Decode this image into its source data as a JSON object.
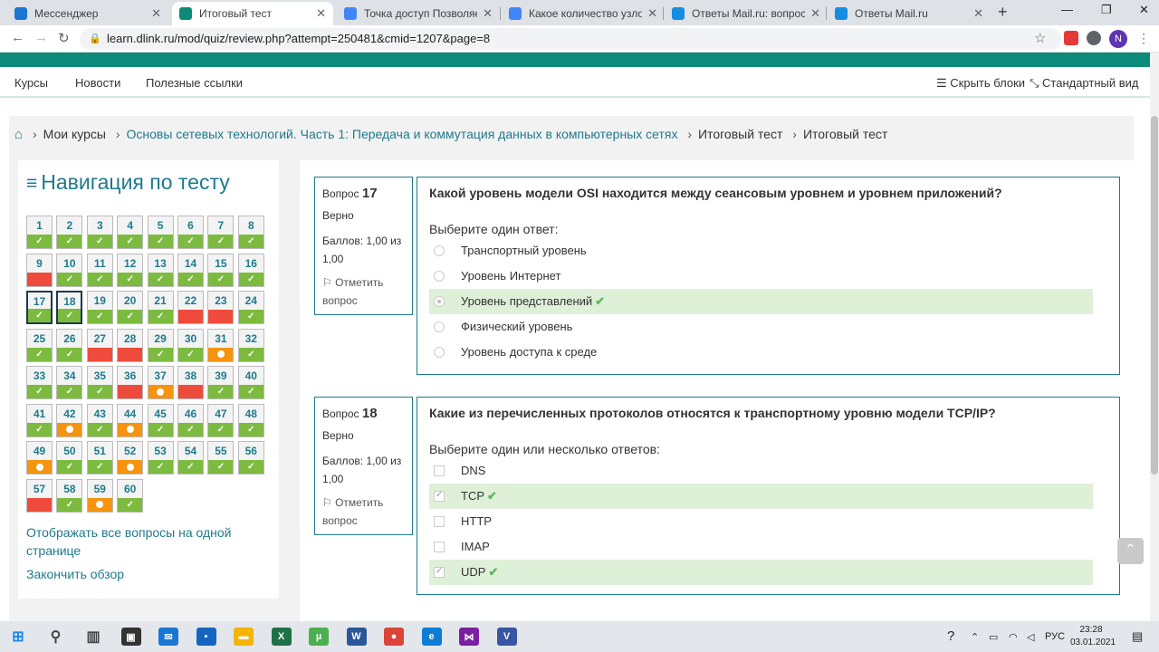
{
  "browser": {
    "tabs": [
      {
        "title": "Мессенджер",
        "icon": "messenger-icon",
        "color": "#1976d2"
      },
      {
        "title": "Итоговый тест",
        "icon": "dlink-icon",
        "color": "#0e8a7b"
      },
      {
        "title": "Точка доступ Позволяет об",
        "icon": "google-icon",
        "color": "#4285f4"
      },
      {
        "title": "Какое количество узлов до",
        "icon": "google-icon",
        "color": "#4285f4"
      },
      {
        "title": "Ответы Mail.ru: вопрос",
        "icon": "mailru-icon",
        "color": "#168de2"
      },
      {
        "title": "Ответы Mail.ru",
        "icon": "mailru-icon",
        "color": "#168de2"
      }
    ],
    "active_tab": 1,
    "url": "learn.dlink.ru/mod/quiz/review.php?attempt=250481&cmid=1207&page=8",
    "profile_initial": "N"
  },
  "site": {
    "nav": [
      "Курсы",
      "Новости",
      "Полезные ссылки"
    ],
    "hide_blocks": "Скрыть блоки",
    "standard_view": "Стандартный вид",
    "brand_color": "#0e8a7b",
    "link_color": "#1f7a8c"
  },
  "breadcrumb": [
    "Мои курсы",
    "Основы сетевых технологий. Часть 1: Передача и коммутация данных в компьютерных сетях",
    "Итоговый тест",
    "Итоговый тест"
  ],
  "quiz_nav": {
    "title": "Навигация по тесту",
    "questions": [
      {
        "n": "1",
        "s": "correct"
      },
      {
        "n": "2",
        "s": "correct"
      },
      {
        "n": "3",
        "s": "correct"
      },
      {
        "n": "4",
        "s": "correct"
      },
      {
        "n": "5",
        "s": "correct"
      },
      {
        "n": "6",
        "s": "correct"
      },
      {
        "n": "7",
        "s": "correct"
      },
      {
        "n": "8",
        "s": "correct"
      },
      {
        "n": "9",
        "s": "wrong"
      },
      {
        "n": "10",
        "s": "correct"
      },
      {
        "n": "11",
        "s": "correct"
      },
      {
        "n": "12",
        "s": "correct"
      },
      {
        "n": "13",
        "s": "correct"
      },
      {
        "n": "14",
        "s": "correct"
      },
      {
        "n": "15",
        "s": "correct"
      },
      {
        "n": "16",
        "s": "correct"
      },
      {
        "n": "17",
        "s": "correct",
        "cur": true
      },
      {
        "n": "18",
        "s": "correct",
        "cur": true
      },
      {
        "n": "19",
        "s": "correct"
      },
      {
        "n": "20",
        "s": "correct"
      },
      {
        "n": "21",
        "s": "correct"
      },
      {
        "n": "22",
        "s": "wrong"
      },
      {
        "n": "23",
        "s": "wrong"
      },
      {
        "n": "24",
        "s": "correct"
      },
      {
        "n": "25",
        "s": "correct"
      },
      {
        "n": "26",
        "s": "correct"
      },
      {
        "n": "27",
        "s": "wrong"
      },
      {
        "n": "28",
        "s": "wrong"
      },
      {
        "n": "29",
        "s": "correct"
      },
      {
        "n": "30",
        "s": "correct"
      },
      {
        "n": "31",
        "s": "partial"
      },
      {
        "n": "32",
        "s": "correct"
      },
      {
        "n": "33",
        "s": "correct"
      },
      {
        "n": "34",
        "s": "correct"
      },
      {
        "n": "35",
        "s": "correct"
      },
      {
        "n": "36",
        "s": "wrong"
      },
      {
        "n": "37",
        "s": "partial"
      },
      {
        "n": "38",
        "s": "wrong"
      },
      {
        "n": "39",
        "s": "correct"
      },
      {
        "n": "40",
        "s": "correct"
      },
      {
        "n": "41",
        "s": "correct"
      },
      {
        "n": "42",
        "s": "partial"
      },
      {
        "n": "43",
        "s": "correct"
      },
      {
        "n": "44",
        "s": "partial"
      },
      {
        "n": "45",
        "s": "correct"
      },
      {
        "n": "46",
        "s": "correct"
      },
      {
        "n": "47",
        "s": "correct"
      },
      {
        "n": "48",
        "s": "correct"
      },
      {
        "n": "49",
        "s": "partial"
      },
      {
        "n": "50",
        "s": "correct"
      },
      {
        "n": "51",
        "s": "correct"
      },
      {
        "n": "52",
        "s": "partial"
      },
      {
        "n": "53",
        "s": "correct"
      },
      {
        "n": "54",
        "s": "correct"
      },
      {
        "n": "55",
        "s": "correct"
      },
      {
        "n": "56",
        "s": "correct"
      },
      {
        "n": "57",
        "s": "wrong"
      },
      {
        "n": "58",
        "s": "correct"
      },
      {
        "n": "59",
        "s": "partial"
      },
      {
        "n": "60",
        "s": "correct"
      }
    ],
    "show_all": "Отображать все вопросы на одной странице",
    "finish": "Закончить обзор"
  },
  "questions": [
    {
      "label": "Вопрос",
      "number": "17",
      "state": "Верно",
      "grade": "Баллов: 1,00 из 1,00",
      "flag": "Отметить вопрос",
      "text": "Какой уровень модели OSI находится между сеансовым уровнем и уровнем приложений?",
      "prompt": "Выберите один ответ:",
      "type": "radio",
      "answers": [
        {
          "label": "Транспортный уровень",
          "selected": false
        },
        {
          "label": "Уровень Интернет",
          "selected": false
        },
        {
          "label": "Уровень представлений",
          "selected": true
        },
        {
          "label": "Физический уровень",
          "selected": false
        },
        {
          "label": "Уровень доступа к среде",
          "selected": false
        }
      ]
    },
    {
      "label": "Вопрос",
      "number": "18",
      "state": "Верно",
      "grade": "Баллов: 1,00 из 1,00",
      "flag": "Отметить вопрос",
      "text": "Какие из перечисленных протоколов относятся к транспортному уровню модели TCP/IP?",
      "prompt": "Выберите один или несколько ответов:",
      "type": "checkbox",
      "answers": [
        {
          "label": "DNS",
          "selected": false
        },
        {
          "label": "TCP",
          "selected": true
        },
        {
          "label": "HTTP",
          "selected": false
        },
        {
          "label": "IMAP",
          "selected": false
        },
        {
          "label": "UDP",
          "selected": true
        }
      ]
    }
  ],
  "taskbar": {
    "apps": [
      "windows-start-icon",
      "search-icon",
      "task-view-icon",
      "store-icon",
      "mail-icon",
      "save-icon",
      "file-explorer-icon",
      "excel-icon",
      "utorrent-icon",
      "word-icon",
      "chrome-icon",
      "edge-icon",
      "visual-studio-icon",
      "visio-icon"
    ],
    "lang": "РУС",
    "time": "23:28",
    "date": "03.01.2021"
  }
}
